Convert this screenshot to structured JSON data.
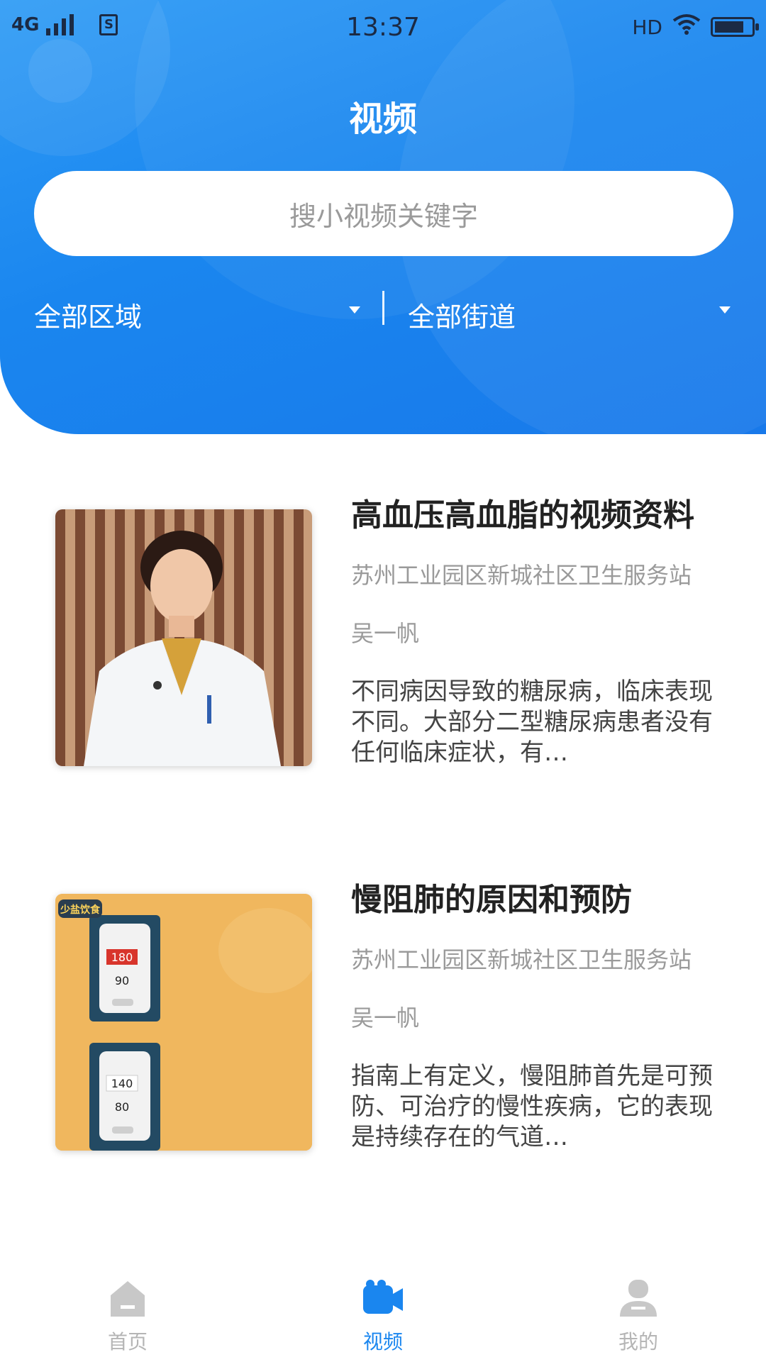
{
  "status_bar": {
    "network": "4G",
    "time": "13:37",
    "hd": "HD"
  },
  "header": {
    "title": "视频",
    "search_placeholder": "搜小视频关键字",
    "filter_area": "全部区域",
    "filter_street": "全部街道"
  },
  "videos": [
    {
      "title": "高血压高血脂的视频资料",
      "organization": "苏州工业园区新城社区卫生服务站",
      "author": "吴一帆",
      "description": "不同病因导致的糖尿病，临床表现不同。大部分二型糖尿病患者没有任何临床症状，有…"
    },
    {
      "title": "慢阻肺的原因和预防",
      "organization": "苏州工业园区新城社区卫生服务站",
      "author": "吴一帆",
      "description": "指南上有定义，慢阻肺首先是可预防、可治疗的慢性疾病，它的表现是持续存在的气道…"
    }
  ],
  "thumb2_text": {
    "logo": "少盐饮食",
    "reading1_top": "180",
    "reading1_bottom": "90",
    "reading2_top": "140",
    "reading2_bottom": "80"
  },
  "tabs": [
    {
      "label": "首页",
      "icon": "home-icon",
      "active": false
    },
    {
      "label": "视频",
      "icon": "video-camera-icon",
      "active": true
    },
    {
      "label": "我的",
      "icon": "user-icon",
      "active": false
    }
  ],
  "colors": {
    "primary": "#1a86ef",
    "inactive_tab": "#b5b5b5"
  }
}
